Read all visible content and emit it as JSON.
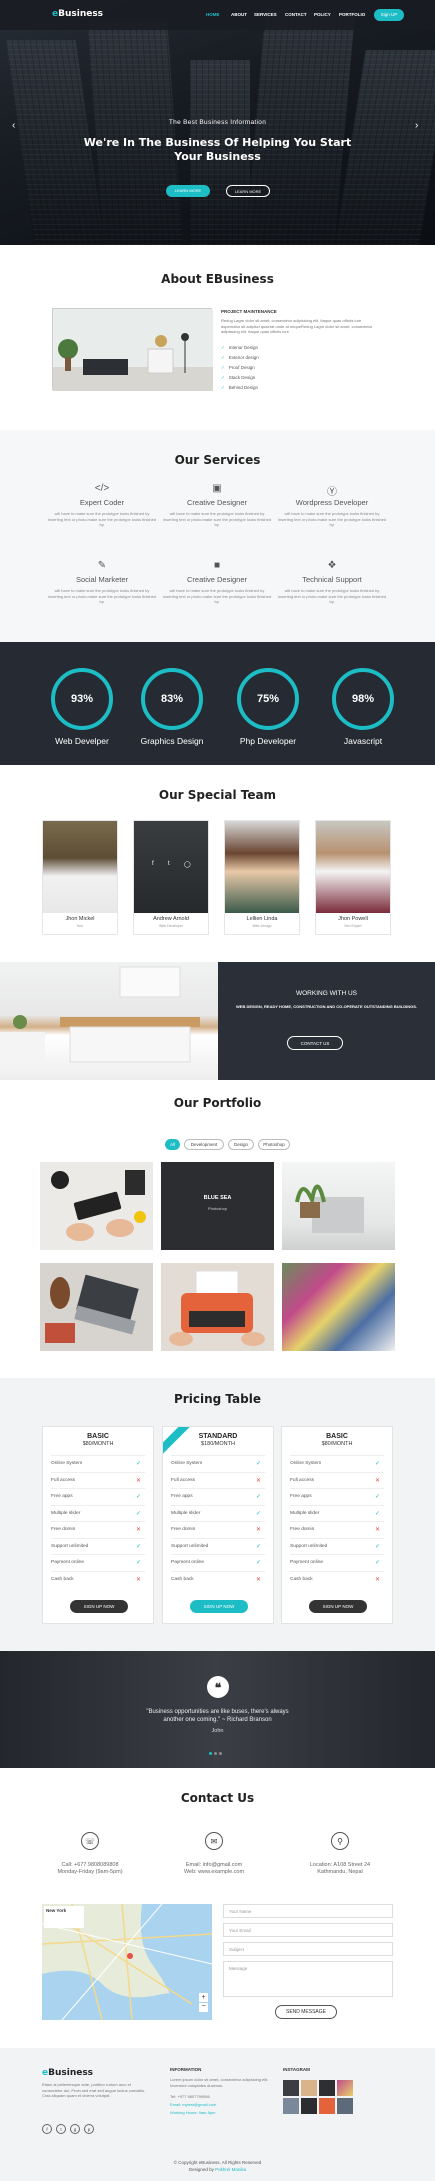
{
  "brand": {
    "e": "e",
    "name": "Business"
  },
  "nav": {
    "items": [
      "HOME",
      "ABOUT",
      "SERVICES",
      "CONTACT",
      "POLICY",
      "PORTFOLIO"
    ],
    "signup": "Sign UP"
  },
  "hero": {
    "subtitle": "The Best Business Information",
    "title_line1": "We're In The Business Of Helping You Start",
    "title_line2": "Your Business",
    "btn_primary": "LEARN MORE",
    "btn_secondary": "LEARN MORE",
    "prev_icon": "chevron-left",
    "next_icon": "chevron-right"
  },
  "about": {
    "title": "About EBusiness",
    "heading": "PROJECT MAINTENANCE",
    "text": "Redug Lagre dolor sit amet, consectetur adipisicing elit. Itaque quas officiis iure aspernatur sit adipisci quaerat unde at nequeRedug Lagre dolor sit amet, consectetur adipisicing elit. Itaque quas officiis iure",
    "list": [
      "Interior Design",
      "Exterior design",
      "Proof Design",
      "Stack Design",
      "Behind Design"
    ]
  },
  "services": {
    "title": "Our Services",
    "desc": "will have to make sure the prototype looks finished by inserting text or photo.make sure the prototype looks finished by.",
    "items": [
      {
        "name": "Expert Coder",
        "icon": "code-icon"
      },
      {
        "name": "Creative Designer",
        "icon": "camera-icon"
      },
      {
        "name": "Wordpress Developer",
        "icon": "wordpress-icon"
      },
      {
        "name": "Social Marketer",
        "icon": "bullhorn-icon"
      },
      {
        "name": "Creative Designer",
        "icon": "briefcase-icon"
      },
      {
        "name": "Technical Support",
        "icon": "support-icon"
      }
    ]
  },
  "stats": [
    {
      "value": "93%",
      "label": "Web Develper"
    },
    {
      "value": "83%",
      "label": "Graphics Design"
    },
    {
      "value": "75%",
      "label": "Php Developer"
    },
    {
      "value": "98%",
      "label": "Javascript"
    }
  ],
  "team": {
    "title": "Our Special Team",
    "members": [
      {
        "name": "Jhon Mickel",
        "role": "Seo"
      },
      {
        "name": "Andrew Arnold",
        "role": "Web Developer"
      },
      {
        "name": "Lellien Linda",
        "role": "Web Design"
      },
      {
        "name": "Jhon Powell",
        "role": "Seo Expert"
      }
    ]
  },
  "working": {
    "title": "WORKING WITH US",
    "text": "WEB DESIGN, READY HOME, CONSTRUCTION AND CO-OPERATE OUTSTANDING BUILDINGS.",
    "button": "CONTACT US"
  },
  "portfolio": {
    "title": "Our Portfolio",
    "filters": [
      "All",
      "Development",
      "Design",
      "Photoshop"
    ],
    "overlay_title": "BLUE SEA",
    "overlay_sub": "Photoshop"
  },
  "pricing": {
    "title": "Pricing Table",
    "plans": [
      {
        "name": "BASIC",
        "price": "$80/MONTH",
        "button": "SIGN UP NOW",
        "featured": false
      },
      {
        "name": "STANDARD",
        "price": "$180/MONTH",
        "button": "SIGN UP NOW",
        "featured": true
      },
      {
        "name": "BASIC",
        "price": "$80/MONTH",
        "button": "SIGN UP NOW",
        "featured": false
      }
    ],
    "features": [
      {
        "label": "Online System",
        "ok": [
          true,
          true,
          true
        ]
      },
      {
        "label": "Full access",
        "ok": [
          false,
          false,
          false
        ]
      },
      {
        "label": "Free apps",
        "ok": [
          true,
          true,
          true
        ]
      },
      {
        "label": "Multiple slider",
        "ok": [
          true,
          true,
          true
        ]
      },
      {
        "label": "Free domin",
        "ok": [
          false,
          false,
          false
        ]
      },
      {
        "label": "Support unlimited",
        "ok": [
          true,
          true,
          true
        ]
      },
      {
        "label": "Payment online",
        "ok": [
          true,
          true,
          true
        ]
      },
      {
        "label": "Cash back",
        "ok": [
          false,
          false,
          false
        ]
      }
    ],
    "yes_glyph": "✓",
    "no_glyph": "✕"
  },
  "testimonial": {
    "line1": "\"Business opportunities are like buses, there's always",
    "line2": "another one coming.\" ~ Richard Branson",
    "author": "John"
  },
  "contact": {
    "title": "Contact Us",
    "blocks": [
      {
        "icon": "phone-icon",
        "line1": "Call: +677 9808089808",
        "line2": "Monday-Friday (9am-5pm)"
      },
      {
        "icon": "envelope-icon",
        "line1": "Email: info@gmail.com",
        "line2": "Web: www.example.com"
      },
      {
        "icon": "map-marker-icon",
        "line1": "Location: A108 Street 24",
        "line2": "Kathmandu, Nepal"
      }
    ],
    "form": {
      "name": "Your Name",
      "email": "Your Email",
      "subject": "Subject",
      "message": "Message",
      "button": "SEND MESSAGE"
    },
    "map_label": "New York"
  },
  "footer": {
    "text": "Etiam al pellentesque ante, porttitor rutrum arcu et consectetur dui. Proin sed erat sed augue luctus convallis. Cras aliquam quam et viverra volutpat.",
    "info_heading": "INFORMATION",
    "info_text": "Lorem ipsum dolor sit amet, consectetur adipisicing elit. Inventore voluptates ducimus.",
    "tel": "Tel: +977 9807799066",
    "email": "Email: mytest@gmail.com",
    "hours": "Working Hours: 9am-5pm",
    "instagram": "INSTAGRAM",
    "copyright": "© Copyright eBusiness. All Rights Reserved",
    "designed_prefix": "Designed by",
    "designed_by": "Pokhrel Manika"
  },
  "colors": {
    "accent": "#1dbdc6",
    "dark": "#262b33"
  }
}
